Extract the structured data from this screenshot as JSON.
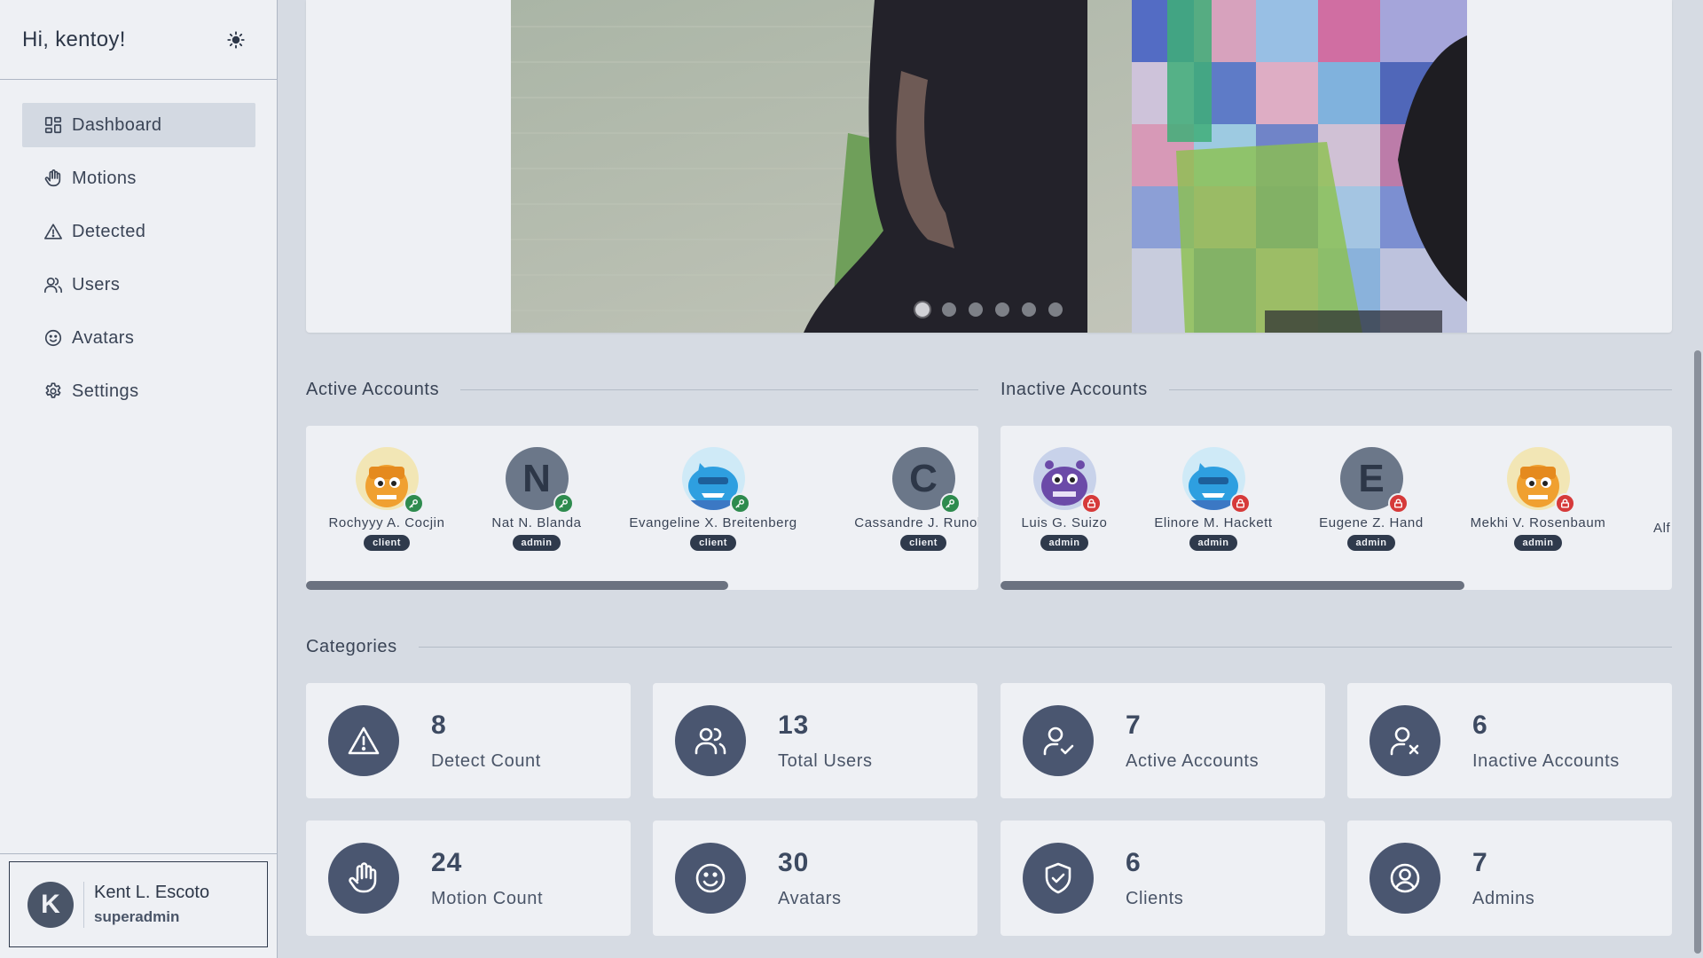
{
  "sidebar": {
    "greeting": "Hi, kentoy!",
    "nav": [
      {
        "label": "Dashboard",
        "icon": "dashboard-icon"
      },
      {
        "label": "Motions",
        "icon": "hand-icon"
      },
      {
        "label": "Detected",
        "icon": "warning-icon"
      },
      {
        "label": "Users",
        "icon": "users-icon"
      },
      {
        "label": "Avatars",
        "icon": "smile-icon"
      },
      {
        "label": "Settings",
        "icon": "gear-icon"
      }
    ],
    "profile": {
      "initial": "K",
      "name": "Kent L. Escoto",
      "role": "superadmin"
    }
  },
  "carousel": {
    "slide_count": 6,
    "active_index": 0
  },
  "active_accounts": {
    "title": "Active Accounts",
    "items": [
      {
        "name": "Rochyyy A. Cocjin",
        "role": "client",
        "avatar": "orange-monster"
      },
      {
        "name": "Nat N. Blanda",
        "role": "admin",
        "initial": "N"
      },
      {
        "name": "Evangeline X. Breitenberg",
        "role": "client",
        "avatar": "blue-shark"
      },
      {
        "name": "Cassandre J. Runolfs",
        "role": "client",
        "initial": "C"
      }
    ]
  },
  "inactive_accounts": {
    "title": "Inactive Accounts",
    "items": [
      {
        "name": "Luis G. Suizo",
        "role": "admin",
        "avatar": "purple-monster"
      },
      {
        "name": "Elinore M. Hackett",
        "role": "admin",
        "avatar": "blue-shark"
      },
      {
        "name": "Eugene Z. Hand",
        "role": "admin",
        "initial": "E"
      },
      {
        "name": "Mekhi V. Rosenbaum",
        "role": "admin",
        "avatar": "orange-monster"
      },
      {
        "name": "Alf"
      }
    ]
  },
  "categories": {
    "title": "Categories",
    "cards": [
      {
        "value": "8",
        "label": "Detect Count",
        "icon": "warning-icon"
      },
      {
        "value": "13",
        "label": "Total Users",
        "icon": "users-icon"
      },
      {
        "value": "7",
        "label": "Active Accounts",
        "icon": "user-check-icon"
      },
      {
        "value": "6",
        "label": "Inactive Accounts",
        "icon": "user-x-icon"
      },
      {
        "value": "24",
        "label": "Motion Count",
        "icon": "hand-icon"
      },
      {
        "value": "30",
        "label": "Avatars",
        "icon": "smile-icon"
      },
      {
        "value": "6",
        "label": "Clients",
        "icon": "shield-check-icon"
      },
      {
        "value": "7",
        "label": "Admins",
        "icon": "user-circle-icon"
      }
    ]
  },
  "colors": {
    "accent": "#4a5670",
    "active_badge": "#2e8b4e",
    "inactive_badge": "#d63a3a",
    "panel": "#eef0f4",
    "background": "#d6dbe3"
  }
}
